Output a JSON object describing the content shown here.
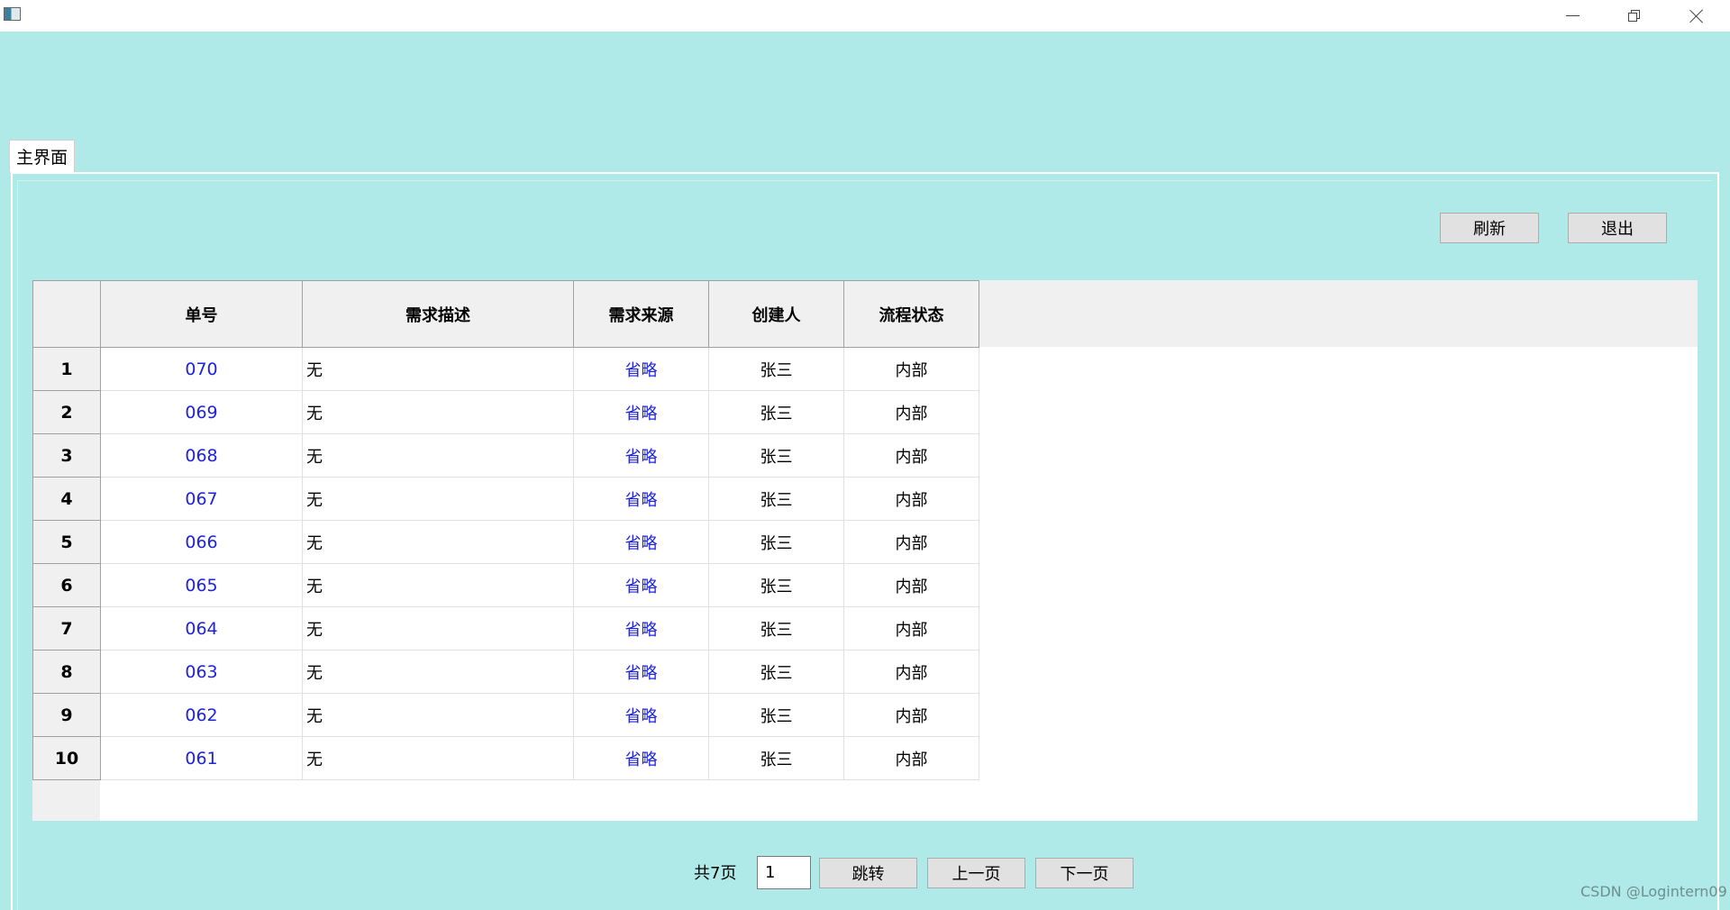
{
  "window": {
    "minimize_glyph": "",
    "maximize_glyph": "",
    "close_glyph": ""
  },
  "tabs": [
    {
      "label": "主界面"
    }
  ],
  "toolbar": {
    "refresh_label": "刷新",
    "exit_label": "退出"
  },
  "table": {
    "columns": [
      "单号",
      "需求描述",
      "需求来源",
      "创建人",
      "流程状态"
    ],
    "rows": [
      {
        "num": "1",
        "id": "070",
        "desc": "无",
        "source": "省略",
        "creator": "张三",
        "status": "内部"
      },
      {
        "num": "2",
        "id": "069",
        "desc": "无",
        "source": "省略",
        "creator": "张三",
        "status": "内部"
      },
      {
        "num": "3",
        "id": "068",
        "desc": "无",
        "source": "省略",
        "creator": "张三",
        "status": "内部"
      },
      {
        "num": "4",
        "id": "067",
        "desc": "无",
        "source": "省略",
        "creator": "张三",
        "status": "内部"
      },
      {
        "num": "5",
        "id": "066",
        "desc": "无",
        "source": "省略",
        "creator": "张三",
        "status": "内部"
      },
      {
        "num": "6",
        "id": "065",
        "desc": "无",
        "source": "省略",
        "creator": "张三",
        "status": "内部"
      },
      {
        "num": "7",
        "id": "064",
        "desc": "无",
        "source": "省略",
        "creator": "张三",
        "status": "内部"
      },
      {
        "num": "8",
        "id": "063",
        "desc": "无",
        "source": "省略",
        "creator": "张三",
        "status": "内部"
      },
      {
        "num": "9",
        "id": "062",
        "desc": "无",
        "source": "省略",
        "creator": "张三",
        "status": "内部"
      },
      {
        "num": "10",
        "id": "061",
        "desc": "无",
        "source": "省略",
        "creator": "张三",
        "status": "内部"
      }
    ]
  },
  "pager": {
    "total_label": "共7页",
    "page_value": "1",
    "jump_label": "跳转",
    "prev_label": "上一页",
    "next_label": "下一页"
  },
  "watermark": "CSDN @Logintern09",
  "colors": {
    "background": "#afe9e8",
    "link": "#1d22dd"
  }
}
